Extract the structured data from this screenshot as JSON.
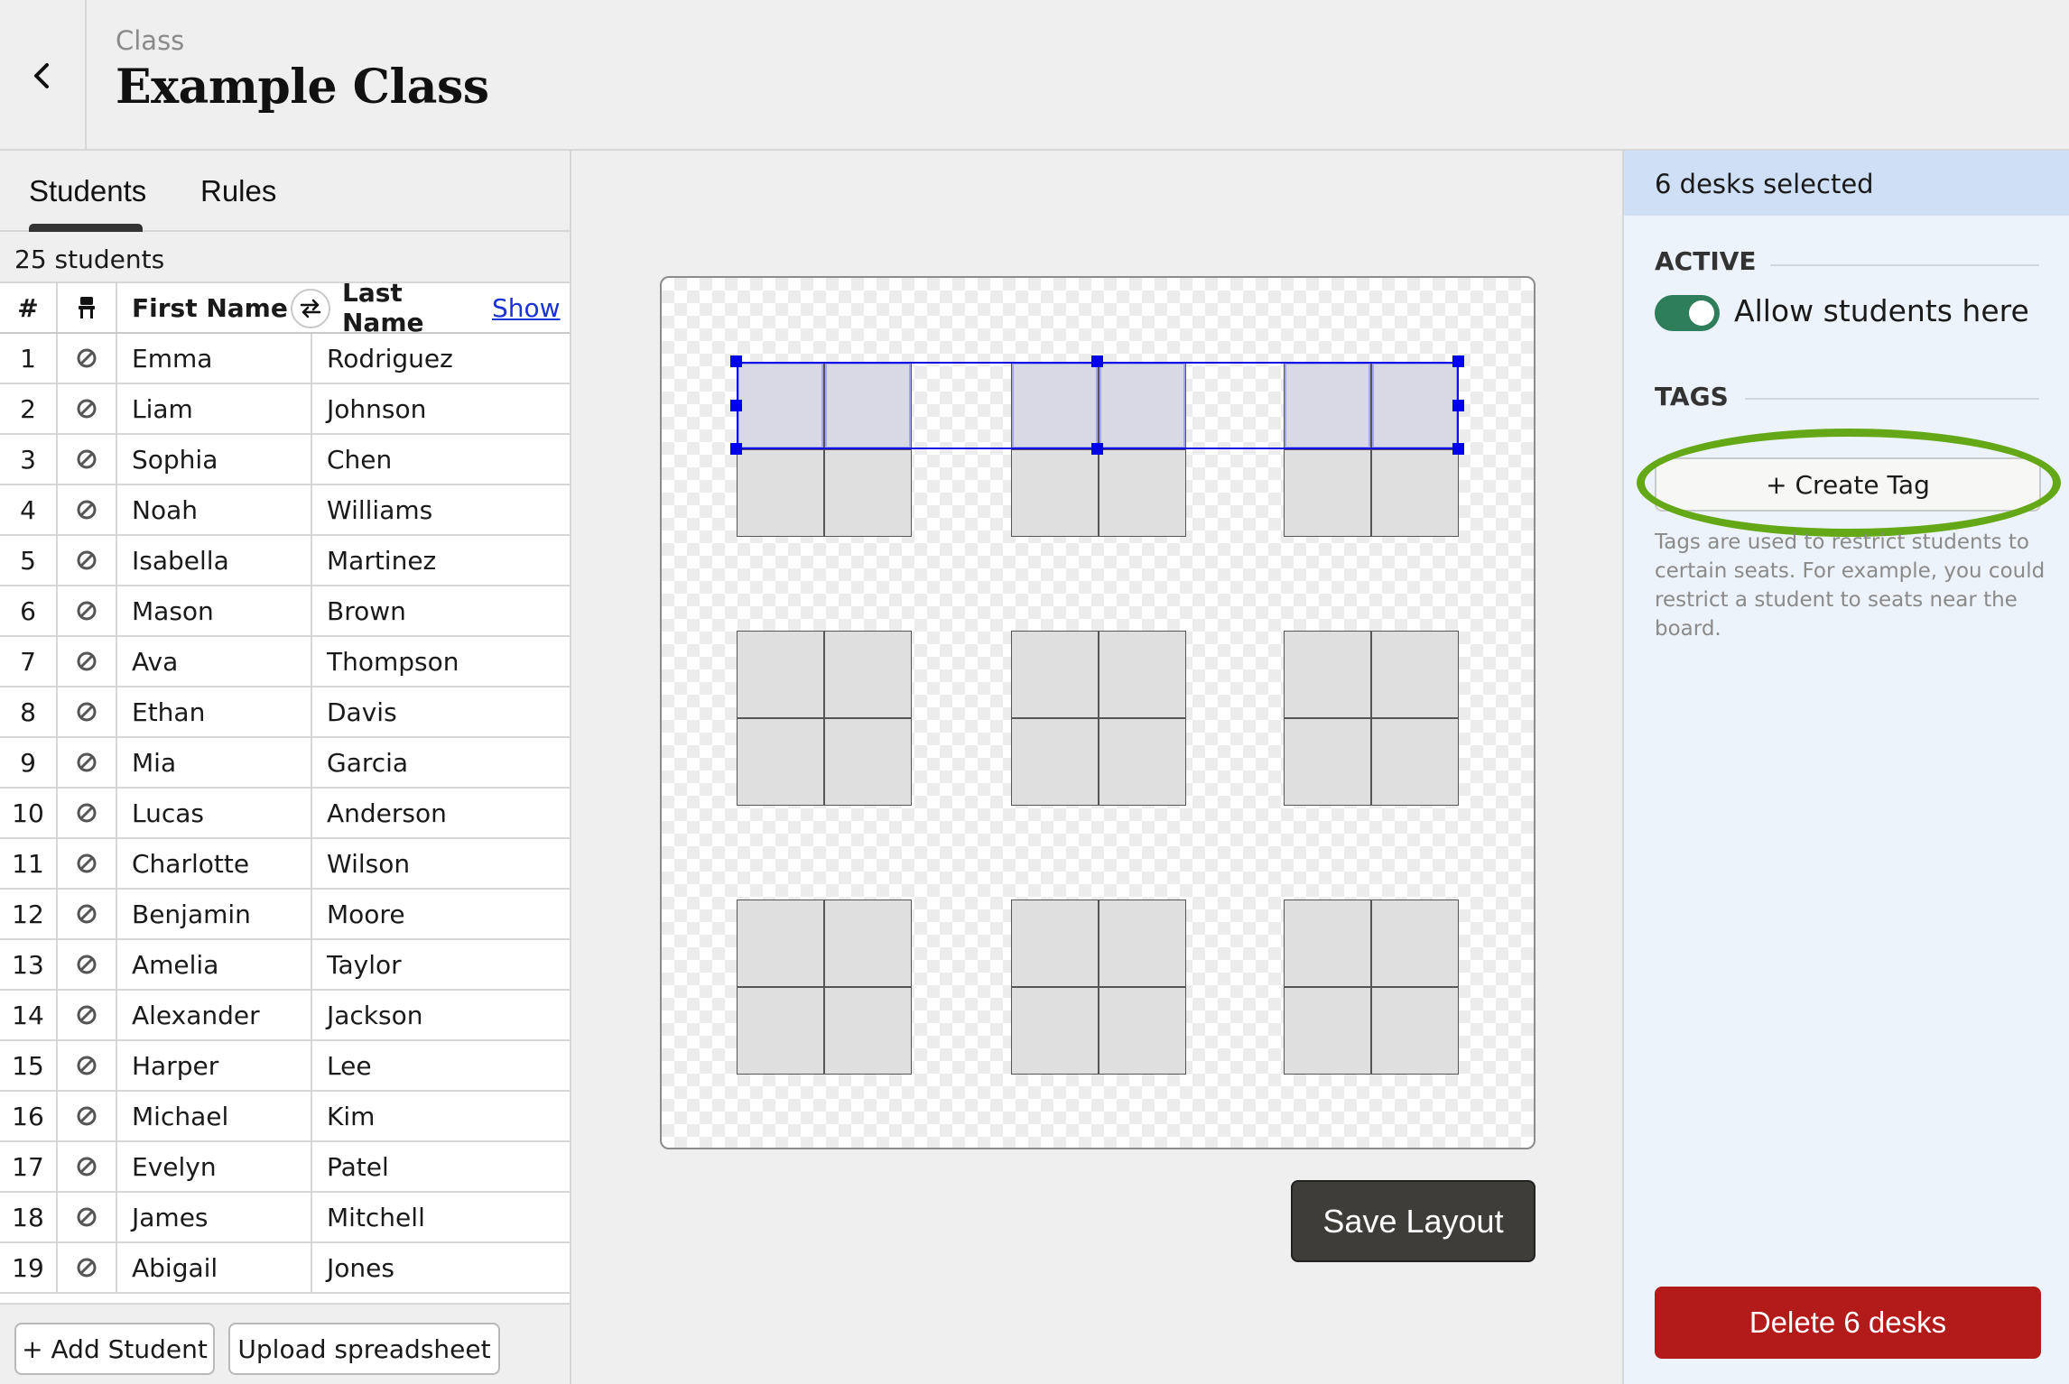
{
  "header": {
    "back_icon": "chevron-left-icon",
    "class_label": "Class",
    "class_title": "Example Class"
  },
  "tabs": [
    {
      "label": "Students",
      "active": true
    },
    {
      "label": "Rules",
      "active": false
    }
  ],
  "student_count": "25 students",
  "table": {
    "headers": {
      "num": "#",
      "desk_icon": "chair-icon",
      "first": "First Name",
      "swap_icon": "swap-icon",
      "last": "Last Name",
      "show": "Show"
    },
    "row_icon": "unassigned-icon",
    "rows": [
      {
        "num": "1",
        "first": "Emma",
        "last": "Rodriguez"
      },
      {
        "num": "2",
        "first": "Liam",
        "last": "Johnson"
      },
      {
        "num": "3",
        "first": "Sophia",
        "last": "Chen"
      },
      {
        "num": "4",
        "first": "Noah",
        "last": "Williams"
      },
      {
        "num": "5",
        "first": "Isabella",
        "last": "Martinez"
      },
      {
        "num": "6",
        "first": "Mason",
        "last": "Brown"
      },
      {
        "num": "7",
        "first": "Ava",
        "last": "Thompson"
      },
      {
        "num": "8",
        "first": "Ethan",
        "last": "Davis"
      },
      {
        "num": "9",
        "first": "Mia",
        "last": "Garcia"
      },
      {
        "num": "10",
        "first": "Lucas",
        "last": "Anderson"
      },
      {
        "num": "11",
        "first": "Charlotte",
        "last": "Wilson"
      },
      {
        "num": "12",
        "first": "Benjamin",
        "last": "Moore"
      },
      {
        "num": "13",
        "first": "Amelia",
        "last": "Taylor"
      },
      {
        "num": "14",
        "first": "Alexander",
        "last": "Jackson"
      },
      {
        "num": "15",
        "first": "Harper",
        "last": "Lee"
      },
      {
        "num": "16",
        "first": "Michael",
        "last": "Kim"
      },
      {
        "num": "17",
        "first": "Evelyn",
        "last": "Patel"
      },
      {
        "num": "18",
        "first": "James",
        "last": "Mitchell"
      },
      {
        "num": "19",
        "first": "Abigail",
        "last": "Jones"
      }
    ]
  },
  "left_footer": {
    "add_student": "+ Add Student",
    "upload": "Upload spreadsheet"
  },
  "layout": {
    "desk_groups_grid": "3x3",
    "desks_per_group": 4,
    "selected_desks": "top row of each group in first row",
    "save_label": "Save Layout"
  },
  "panel": {
    "selection_banner": "6 desks selected",
    "active_title": "ACTIVE",
    "toggle_label": "Allow students here",
    "toggle_on": true,
    "tags_title": "TAGS",
    "create_tag": "+ Create Tag",
    "help_text": "Tags are used to restrict students to certain seats. For example, you could restrict a student to seats near the board.",
    "delete_label": "Delete 6 desks",
    "colors": {
      "toggle": "#2e7d5b",
      "delete": "#b31b1b",
      "highlight_oval": "#64a818",
      "selection": "#0000ee"
    }
  }
}
